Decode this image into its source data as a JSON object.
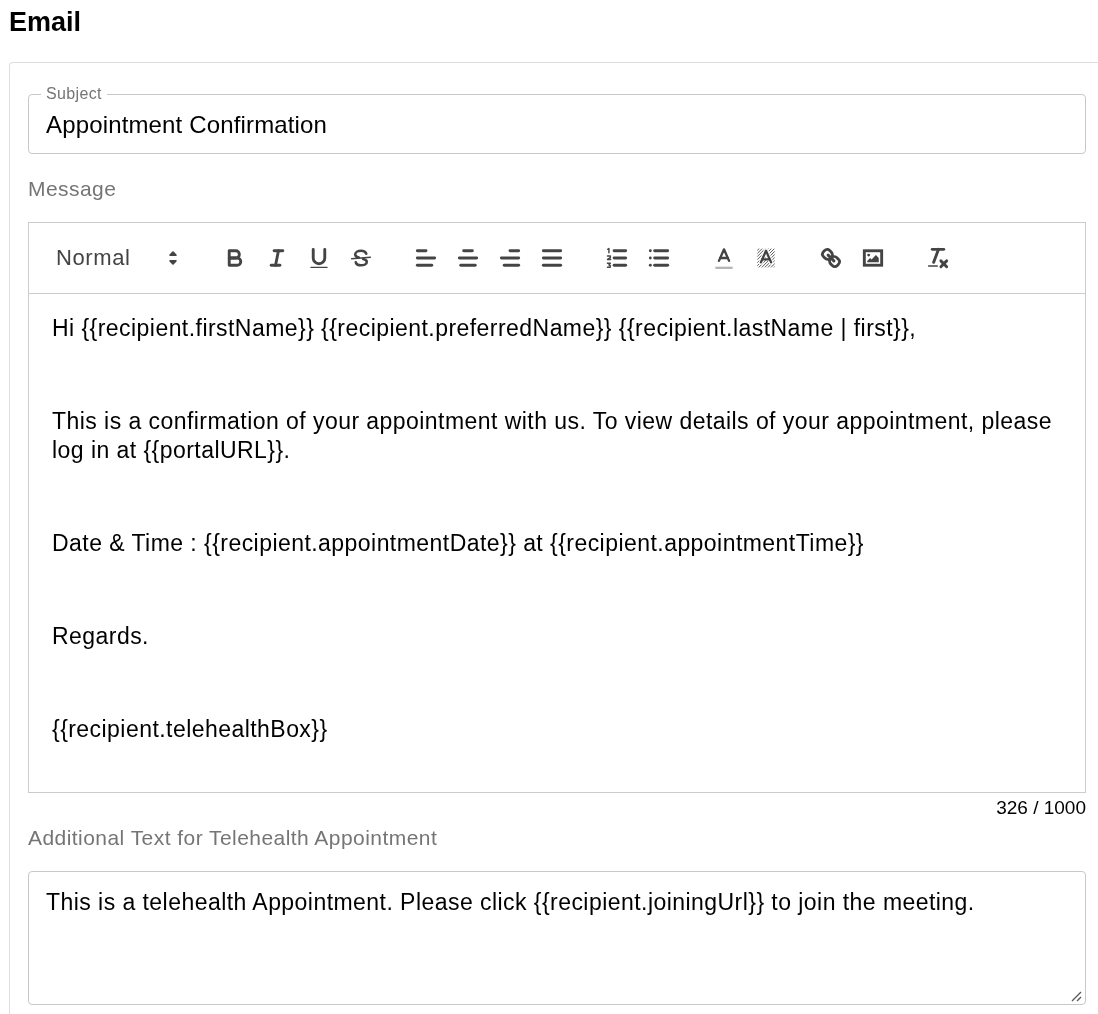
{
  "page": {
    "title": "Email"
  },
  "subject": {
    "label": "Subject",
    "value": "Appointment Confirmation"
  },
  "message": {
    "label": "Message",
    "toolbar": {
      "header": "Normal",
      "groups": [
        [
          {
            "kind": "bold"
          },
          {
            "kind": "italic"
          },
          {
            "kind": "underline"
          },
          {
            "kind": "strike"
          }
        ],
        [
          {
            "kind": "align-left"
          },
          {
            "kind": "align-center"
          },
          {
            "kind": "align-right"
          },
          {
            "kind": "justify"
          }
        ],
        [
          {
            "kind": "ordered-list"
          },
          {
            "kind": "bullet-list"
          }
        ],
        [
          {
            "kind": "color"
          },
          {
            "kind": "background"
          }
        ],
        [
          {
            "kind": "link"
          },
          {
            "kind": "image"
          }
        ],
        [
          {
            "kind": "clean"
          }
        ]
      ]
    },
    "paragraphs": [
      "Hi {{recipient.firstName}} {{recipient.preferredName}} {{recipient.lastName | first}},",
      "This is a confirmation of your appointment with us. To view details of your appointment, please log in at {{portalURL}}.",
      "Date & Time : {{recipient.appointmentDate}} at {{recipient.appointmentTime}}",
      "Regards.",
      "{{recipient.telehealthBox}}"
    ],
    "counter": "326 / 1000"
  },
  "telehealth": {
    "label": "Additional Text for Telehealth Appointment",
    "value": "This is a telehealth Appointment. Please click {{recipient.joiningUrl}} to join the meeting."
  }
}
